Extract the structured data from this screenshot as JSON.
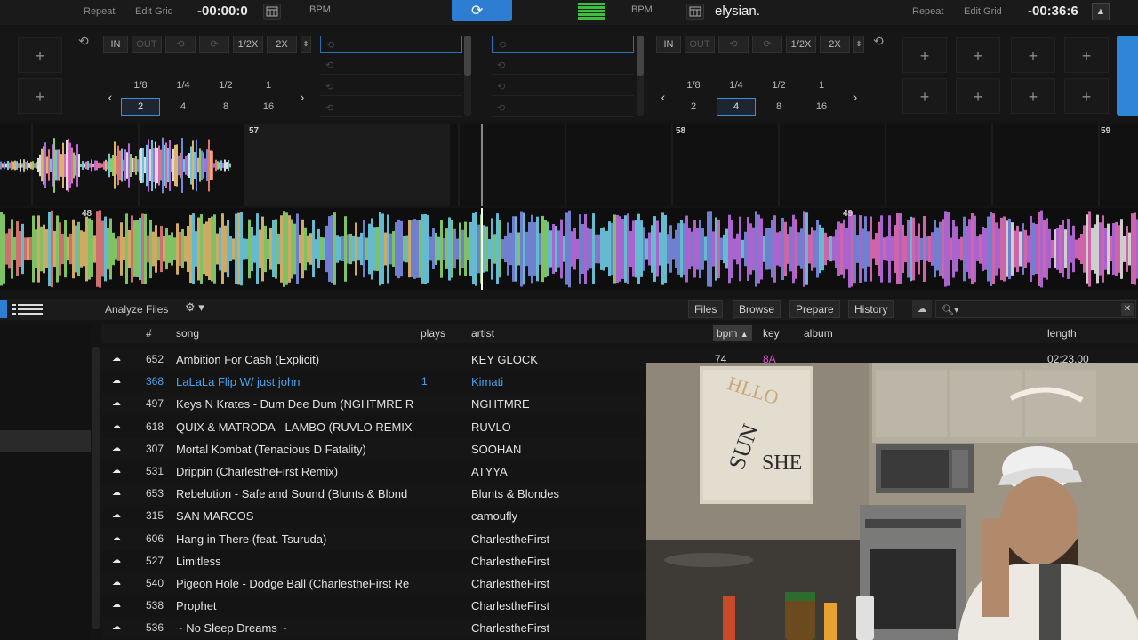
{
  "topbar": {
    "left": {
      "repeat": "Repeat",
      "edit_grid": "Edit Grid",
      "time": "-00:00:0",
      "bpm": "BPM"
    },
    "right": {
      "bpm": "BPM",
      "track_title": "elysian.",
      "repeat": "Repeat",
      "edit_grid": "Edit Grid",
      "time": "-00:36:6"
    }
  },
  "deck_left": {
    "in": "IN",
    "out": "OUT",
    "half": "1/2X",
    "double": "2X",
    "loops_row1": [
      "1/8",
      "1/4",
      "1/2",
      "1"
    ],
    "loops_row2": [
      "2",
      "4",
      "8",
      "16"
    ],
    "selected_loop": "2"
  },
  "deck_right": {
    "in": "IN",
    "out": "OUT",
    "half": "1/2X",
    "double": "2X",
    "loops_row1": [
      "1/8",
      "1/4",
      "1/2",
      "1"
    ],
    "loops_row2": [
      "2",
      "4",
      "8",
      "16"
    ],
    "selected_loop": "4"
  },
  "pads": {
    "plus": "+"
  },
  "waveform": {
    "top_marks": [
      "57",
      "58",
      "59"
    ],
    "main_marks": [
      "48",
      "49"
    ]
  },
  "browser": {
    "analyze": "Analyze Files",
    "nav": [
      "Files",
      "Browse",
      "Prepare",
      "History"
    ],
    "search_placeholder": ""
  },
  "columns": {
    "num": "#",
    "song": "song",
    "plays": "plays",
    "artist": "artist",
    "bpm": "bpm",
    "key": "key",
    "album": "album",
    "length": "length"
  },
  "tracks": [
    {
      "num": "652",
      "song": "Ambition For Cash (Explicit)",
      "plays": "",
      "artist": "KEY GLOCK",
      "bpm": "74",
      "key": "8A",
      "length": "02:23.00"
    },
    {
      "num": "368",
      "song": "LaLaLa Flip W/ just john",
      "plays": "1",
      "artist": "Kimati"
    },
    {
      "num": "497",
      "song": "Keys N Krates - Dum Dee Dum (NGHTMRE R",
      "plays": "",
      "artist": "NGHTMRE"
    },
    {
      "num": "618",
      "song": "QUIX & MATRODA - LAMBO (RUVLO REMIX)",
      "plays": "",
      "artist": "RUVLO"
    },
    {
      "num": "307",
      "song": "Mortal Kombat (Tenacious D Fatality)",
      "plays": "",
      "artist": "SOOHAN"
    },
    {
      "num": "531",
      "song": "Drippin (CharlestheFirst Remix)",
      "plays": "",
      "artist": "ATYYA"
    },
    {
      "num": "653",
      "song": "Rebelution - Safe and Sound (Blunts & Blond",
      "plays": "",
      "artist": "Blunts & Blondes"
    },
    {
      "num": "315",
      "song": "SAN MARCOS",
      "plays": "",
      "artist": "camoufly"
    },
    {
      "num": "606",
      "song": "Hang in There (feat. Tsuruda)",
      "plays": "",
      "artist": "CharlestheFirst"
    },
    {
      "num": "527",
      "song": "Limitless",
      "plays": "",
      "artist": "CharlestheFirst"
    },
    {
      "num": "540",
      "song": "Pigeon Hole - Dodge Ball (CharlestheFirst Re",
      "plays": "",
      "artist": "CharlestheFirst"
    },
    {
      "num": "538",
      "song": "Prophet",
      "plays": "",
      "artist": "CharlestheFirst"
    },
    {
      "num": "536",
      "song": "~ No Sleep Dreams ~",
      "plays": "",
      "artist": "CharlestheFirst"
    }
  ],
  "highlighted_index": 1,
  "colors": {
    "accent": "#2d7dd2",
    "highlight_text": "#44a3ef",
    "key_color": "#e04ed6"
  }
}
